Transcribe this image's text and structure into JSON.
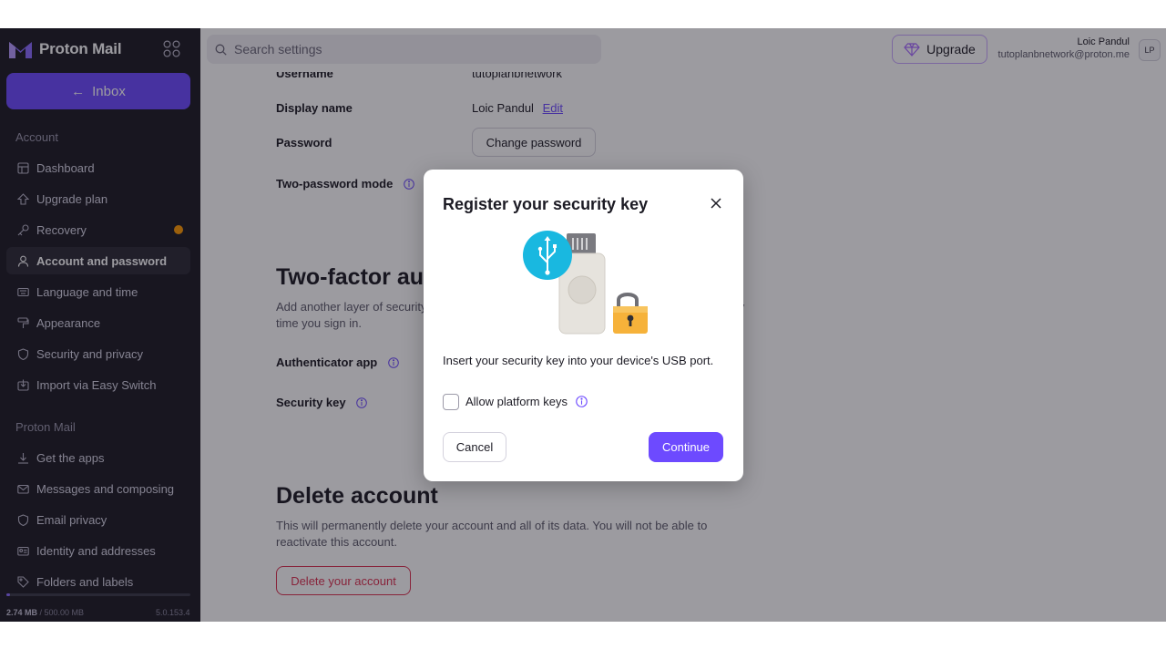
{
  "brand": {
    "name": "Proton Mail"
  },
  "sidebar": {
    "inbox_label": "Inbox",
    "sections": [
      {
        "title": "Account"
      },
      {
        "title": "Proton Mail"
      }
    ],
    "account_items": [
      {
        "label": "Dashboard",
        "icon": "dashboard-icon"
      },
      {
        "label": "Upgrade plan",
        "icon": "upgrade-icon"
      },
      {
        "label": "Recovery",
        "icon": "key-icon",
        "has_alert": true
      },
      {
        "label": "Account and password",
        "icon": "user-icon",
        "active": true
      },
      {
        "label": "Language and time",
        "icon": "keyboard-icon"
      },
      {
        "label": "Appearance",
        "icon": "paint-roller-icon"
      },
      {
        "label": "Security and privacy",
        "icon": "shield-icon"
      },
      {
        "label": "Import via Easy Switch",
        "icon": "import-icon"
      }
    ],
    "mail_items": [
      {
        "label": "Get the apps",
        "icon": "download-icon"
      },
      {
        "label": "Messages and composing",
        "icon": "envelope-icon"
      },
      {
        "label": "Email privacy",
        "icon": "shield-icon"
      },
      {
        "label": "Identity and addresses",
        "icon": "id-card-icon"
      },
      {
        "label": "Folders and labels",
        "icon": "tag-icon"
      }
    ],
    "storage": {
      "used": "2.74 MB",
      "total": "/ 500.00 MB",
      "fraction": 0.0055
    },
    "version": "5.0.153.4"
  },
  "header": {
    "search_placeholder": "Search settings",
    "upgrade_label": "Upgrade",
    "user_name": "Loic Pandul",
    "user_email": "tutoplanbnetwork@proton.me",
    "avatar_initials": "LP"
  },
  "account": {
    "username_label": "Username",
    "username_value": "tutoplanbnetwork",
    "display_name_label": "Display name",
    "display_name_value": "Loic Pandul",
    "edit_label": "Edit",
    "password_label": "Password",
    "change_password_label": "Change password",
    "two_password_label": "Two-password mode"
  },
  "two_factor": {
    "title": "Two-factor authentication",
    "description": "Add another layer of security to your account. You'll need to verify yourself with 2FA every time you sign in.",
    "authenticator_label": "Authenticator app",
    "security_key_label": "Security key"
  },
  "delete_account": {
    "title": "Delete account",
    "description": "This will permanently delete your account and all of its data. You will not be able to reactivate this account.",
    "button_label": "Delete your account"
  },
  "modal": {
    "title": "Register your security key",
    "body": "Insert your security key into your device's USB port.",
    "checkbox_label": "Allow platform keys",
    "checkbox_checked": false,
    "cancel_label": "Cancel",
    "continue_label": "Continue"
  },
  "colors": {
    "sidebar_bg": "#1c1b24",
    "accent": "#6d4aff",
    "danger": "#dc3251",
    "alert_dot": "#ff9900"
  }
}
